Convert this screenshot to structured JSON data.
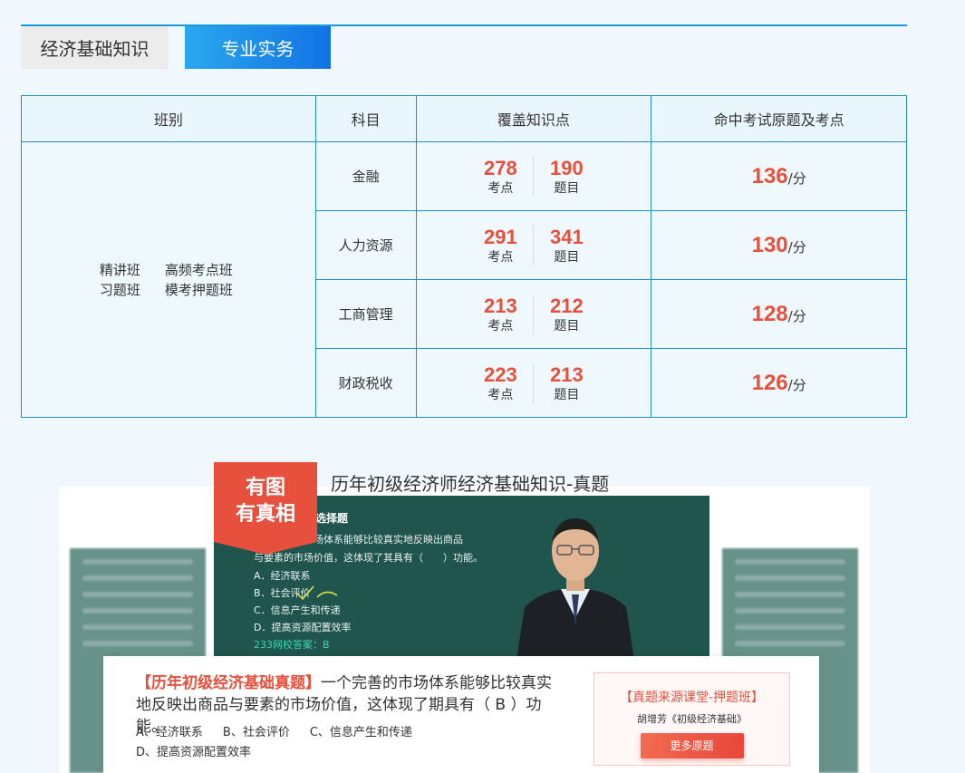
{
  "tabs": [
    {
      "label": "经济基础知识",
      "active": false
    },
    {
      "label": "专业实务",
      "active": true
    }
  ],
  "table": {
    "headers": [
      "班别",
      "科目",
      "覆盖知识点",
      "命中考试原题及考点"
    ],
    "classes": {
      "line1": [
        "精讲班",
        "高频考点班"
      ],
      "line2": [
        "习题班",
        "模考押题班"
      ]
    },
    "rows": [
      {
        "subject": "金融",
        "points": "278",
        "points_label": "考点",
        "questions": "190",
        "questions_label": "题目",
        "hit": "136",
        "hit_unit": "/分"
      },
      {
        "subject": "人力资源",
        "points": "291",
        "points_label": "考点",
        "questions": "341",
        "questions_label": "题目",
        "hit": "130",
        "hit_unit": "/分"
      },
      {
        "subject": "工商管理",
        "points": "213",
        "points_label": "考点",
        "questions": "212",
        "questions_label": "题目",
        "hit": "128",
        "hit_unit": "/分"
      },
      {
        "subject": "财政税收",
        "points": "223",
        "points_label": "考点",
        "questions": "213",
        "questions_label": "题目",
        "hit": "126",
        "hit_unit": "/分"
      }
    ]
  },
  "showcase": {
    "title": "历年初级经济师经济基础知识-真题",
    "badge_line1": "有图",
    "badge_line2": "有真相",
    "board": {
      "heading": "选择题",
      "line1": "一个完善的市场体系能够比较真实地反映出商品",
      "line2": "与要素的市场价值，这体现了其具有（　　）功能。",
      "opt_a": "A．经济联系",
      "opt_b": "B．社会评价",
      "opt_c": "C．信息产生和传递",
      "opt_d": "D．提高资源配置效率",
      "answer": "233网校答案：B"
    },
    "question": {
      "tag": "【历年初级经济基础真题】",
      "text": "一个完善的市场体系能够比较真实地反映出商品与要素的市场价值，这体现了期具有（ B ）功能。",
      "opt_a": "A、经济联系",
      "opt_b": "B、社会评价",
      "opt_c": "C、信息产生和传递",
      "opt_d": "D、提高资源配置效率"
    },
    "promo": {
      "title": "【真题来源课堂-押题班】",
      "subtitle": "胡增芳《初级经济基础》",
      "button": "更多原题"
    }
  }
}
